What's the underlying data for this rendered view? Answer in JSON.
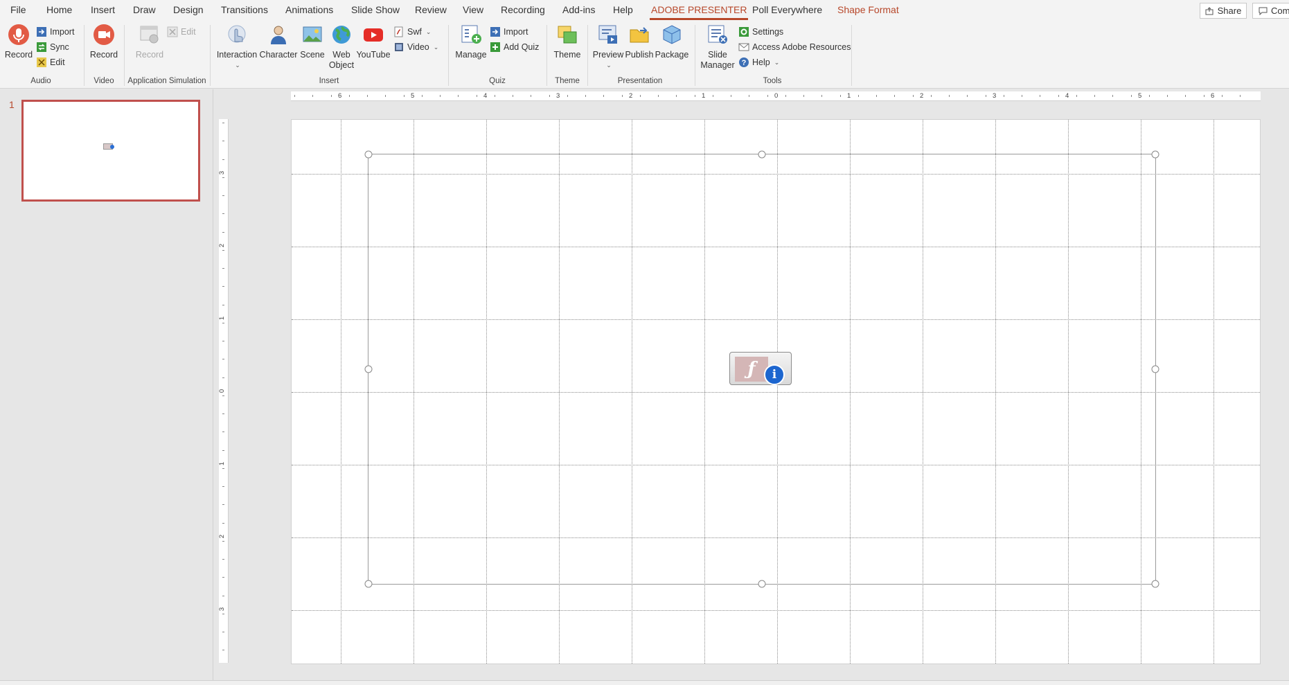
{
  "tabs": [
    "File",
    "Home",
    "Insert",
    "Draw",
    "Design",
    "Transitions",
    "Animations",
    "Slide Show",
    "Review",
    "View",
    "Recording",
    "Add-ins",
    "Help",
    "ADOBE PRESENTER",
    "Poll Everywhere",
    "Shape Format"
  ],
  "active_tab": "ADOBE PRESENTER",
  "share_label": "Share",
  "comments_label": "Comm",
  "ribbon": {
    "audio": {
      "record": "Record",
      "import": "Import",
      "sync": "Sync",
      "edit": "Edit",
      "label": "Audio"
    },
    "video": {
      "record": "Record",
      "label": "Video"
    },
    "appsim": {
      "record": "Record",
      "edit": "Edit",
      "label": "Application Simulation"
    },
    "insert": {
      "interaction": "Interaction",
      "character": "Character",
      "scene": "Scene",
      "web_object_1": "Web",
      "web_object_2": "Object",
      "youtube": "YouTube",
      "swf": "Swf",
      "video": "Video",
      "label": "Insert"
    },
    "quiz": {
      "manage": "Manage",
      "import": "Import",
      "add_quiz": "Add Quiz",
      "label": "Quiz"
    },
    "theme": {
      "theme": "Theme",
      "label": "Theme"
    },
    "presentation": {
      "preview": "Preview",
      "publish": "Publish",
      "package": "Package",
      "label": "Presentation"
    },
    "tools": {
      "slide_manager_1": "Slide",
      "slide_manager_2": "Manager",
      "settings": "Settings",
      "access": "Access Adobe Resources",
      "help": "Help",
      "label": "Tools"
    }
  },
  "slides": [
    {
      "number": "1"
    }
  ],
  "ruler": {
    "h_labels": [
      "6",
      "5",
      "4",
      "3",
      "2",
      "1",
      "0",
      "1",
      "2",
      "3",
      "4",
      "5",
      "6"
    ],
    "v_labels": [
      "3",
      "2",
      "1",
      "0",
      "1",
      "2",
      "3"
    ]
  },
  "colors": {
    "accent": "#b7472a",
    "thumb_border": "#c0504d",
    "info_blue": "#1d66cf"
  }
}
